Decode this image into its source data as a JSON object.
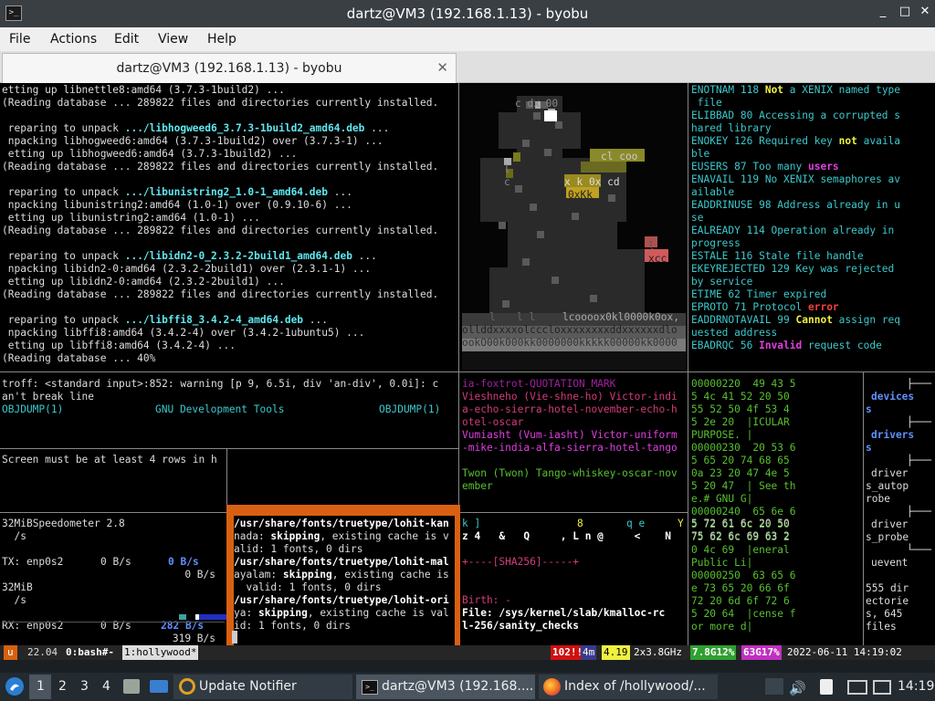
{
  "window": {
    "title": "dartz@VM3 (192.168.1.13) - byobu",
    "minimize": "_",
    "maximize": "□",
    "close": "✕"
  },
  "menu": [
    "File",
    "Actions",
    "Edit",
    "View",
    "Help"
  ],
  "tab": {
    "label": "dartz@VM3 (192.168.1.13) - byobu",
    "close": "✕"
  },
  "apt": {
    "lines": [
      "etting up libnettle8:amd64 (3.7.3-1build2) ...",
      "(Reading database ... 289822 files and directories currently installed.",
      "",
      " reparing to unpack ",
      ".../libhogweed6_3.7.3-1build2_amd64.deb",
      " ...",
      " npacking libhogweed6:amd64 (3.7.3-1build2) over (3.7.3-1) ...",
      " etting up libhogweed6:amd64 (3.7.3-1build2) ...",
      "(Reading database ... 289822 files and directories currently installed.",
      "",
      " reparing to unpack ",
      ".../libunistring2_1.0-1_amd64.deb",
      " ...",
      " npacking libunistring2:amd64 (1.0-1) over (0.9.10-6) ...",
      " etting up libunistring2:amd64 (1.0-1) ...",
      "(Reading database ... 289822 files and directories currently installed.",
      "",
      " reparing to unpack ",
      ".../libidn2-0_2.3.2-2build1_amd64.deb",
      " ...",
      " npacking libidn2-0:amd64 (2.3.2-2build1) over (2.3.1-1) ...",
      " etting up libidn2-0:amd64 (2.3.2-2build1) ...",
      "(Reading database ... 289822 files and directories currently installed.",
      "",
      " reparing to unpack ",
      ".../libffi8_3.4.2-4_amd64.deb",
      " ...",
      " npacking libffi8:amd64 (3.4.2-4) over (3.4.2-1ubuntu5) ...",
      " etting up libffi8:amd64 (3.4.2-4) ...",
      "(Reading database ... 40%"
    ]
  },
  "ascii": {
    "lines": [
      "ollddxxxxolcccloxxxxxxxxddxxxxxxdlo",
      "ookO00k000kk0000000kkkkk00000kk0000"
    ],
    "scraps": [
      "c dx 00",
      "cl coo",
      "l",
      "c",
      "x k 0x cd",
      "0xKk",
      "l",
      "xcc",
      "l",
      "l l",
      "lcoooox0kl0000k0ox,"
    ]
  },
  "errno": [
    [
      "ENOTNAM 118 ",
      "Not",
      " a XENIX named type"
    ],
    [
      " file"
    ],
    [
      "ELIBBAD 80 Accessing a corrupted s"
    ],
    [
      "hared library"
    ],
    [
      "ENOKEY 126 Required key ",
      "not",
      " availa"
    ],
    [
      "ble"
    ],
    [
      "EUSERS 87 Too many ",
      "users"
    ],
    [
      "ENAVAIL 119 No XENIX semaphores av"
    ],
    [
      "ailable"
    ],
    [
      "EADDRINUSE 98 Address already in u"
    ],
    [
      "se"
    ],
    [
      "EALREADY 114 Operation already in"
    ],
    [
      "progress"
    ],
    [
      "ESTALE 116 Stale file handle"
    ],
    [
      "EKEYREJECTED 129 Key was rejected"
    ],
    [
      "by service"
    ],
    [
      "ETIME 62 Timer expired"
    ],
    [
      "EPROTO 71 Protocol ",
      "error"
    ],
    [
      "EADDRNOTAVAIL 99 ",
      "Cannot",
      " assign req"
    ],
    [
      "uested address"
    ],
    [
      "EBADRQC 56 ",
      "Invalid",
      " request code"
    ]
  ],
  "troff": {
    "warn1": "troff: <standard input>:852: warning [p 9, 6.5i, div 'an-div', 0.0i]: c",
    "warn2": "an't break line",
    "objl": "OBJDUMP(1)",
    "objm": "GNU Development Tools",
    "objr": "OBJDUMP(1)"
  },
  "screen_msg": "Screen must be at least 4 rows in h",
  "nato": {
    "l0": "ia-foxtrot-QUOTATION_MARK",
    "l1": "Vieshneho (Vie-shne-ho) Victor-indi",
    "l2": "a-echo-sierra-hotel-november-echo-h",
    "l3": "otel-oscar",
    "l4": "Vumiasht (Vum-iasht) Victor-uniform",
    "l5": "-mike-india-alfa-sierra-hotel-tango",
    "l6": "Twon (Twon) Tango-whiskey-oscar-nov",
    "l7": "ember"
  },
  "hexdump": [
    "00000220  49 43 5",
    "5 4c 41 52 20 50",
    "55 52 50 4f 53 4",
    "5 2e 20  |ICULAR",
    "PURPOSE. |",
    "00000230  20 53 6",
    "5 65 20 74 68 65",
    "0a 23 20 47 4e 5",
    "5 20 47  | See th",
    "e.# GNU G|",
    "00000240  65 6e 6",
    "5 72 61 6c 20 50",
    "75 62 6c 69 63 2",
    "0 4c 69  |eneral",
    "Public Li|",
    "00000250  63 65 6",
    "e 73 65 20 66 6f",
    "72 20 6d 6f 72 6",
    "5 20 64  |cense f",
    "or more d|"
  ],
  "tree": {
    "a": "├───",
    "b": "devices",
    "c": "├───",
    "d": "drivers",
    "e": "driver",
    "f": "s_autop",
    "g": "robe",
    "h": "driver",
    "i": "s_probe",
    "j": "uevent",
    "k": "555 dir",
    "l": "ectorie",
    "m": "s, 645",
    "n": "files"
  },
  "net": {
    "tx_mib": "32MiB",
    "speedometer": "Speedometer 2.8",
    "per_s": "/s",
    "tx_label": "TX: enp0s2",
    "tx_val": "0 B/s",
    "tx_val2": "0 B/s",
    "tx_val3": "0 B/s",
    "rx_mib": "32MiB",
    "per_s2": "/s",
    "rx_label": "RX: enp0s2",
    "rx_val": "0 B/s",
    "rx_val2": "282 B/s",
    "rx_val3": "319 B/s"
  },
  "fc": {
    "l0": "/usr/share/fonts/truetype/lohit-kan",
    "l1a": "nada: ",
    "l1b": "skipping",
    ", existing cache is v": "",
    "l1c": ", existing cache is v",
    "l2": "alid: 1 fonts, 0 dirs",
    "l3": "/usr/share/fonts/truetype/lohit-mal",
    "l4a": "ayalam: ",
    "l4b": "skipping",
    "l4c": ", existing cache is",
    "l5": "  valid: 1 fonts, 0 dirs",
    "l6": "/usr/share/fonts/truetype/lohit-ori",
    "l7a": "ya: ",
    "l7b": "skipping",
    "l7c": ", existing cache is val",
    "l8": "id: 1 fonts, 0 dirs"
  },
  "misc": {
    "m0": "k ]",
    "m0b": "8",
    "m0c": "q e",
    "m0d": "Y",
    "m1": "z 4   &   Q     , L n @     <    N",
    "sha": "+----[SHA256]-----+",
    "birth": "Birth: -",
    "file1": "File: /sys/kernel/slab/kmalloc-rc",
    "file2": "l-256/sanity_checks",
    "hex2a": "5 72 61 6c 20 50",
    "hex2b": "75 62 6c 69 63 2"
  },
  "statusbar": {
    "u": "u",
    "ver": "22.04",
    "win0": "0:bash#-",
    "win1": "1:hollywood*",
    "updates": "102!!",
    "cores": "4m",
    "load": "4.19",
    "cpu": "2x3.8GHz",
    "mem": "7.8G12%",
    "disk": "63G17%",
    "clock": "2022-06-11 14:19:02"
  },
  "colors": {
    "status_updates": "#d01010",
    "status_load": "#f0f040",
    "status_mem": "#30a030",
    "status_disk": "#c030c0",
    "orange": "#d86010"
  },
  "taskbar": {
    "workspaces": [
      "1",
      "2",
      "3",
      "4"
    ],
    "notifier": "Update Notifier",
    "term": "dartz@VM3 (192.168....",
    "firefox": "Index of /hollywood/...",
    "clock": "14:19",
    "icons": [
      "start-menu-icon",
      "file-manager-icon",
      "desktop-icon",
      "volume-icon",
      "clipboard-icon",
      "display-icon",
      "network-icon"
    ]
  }
}
